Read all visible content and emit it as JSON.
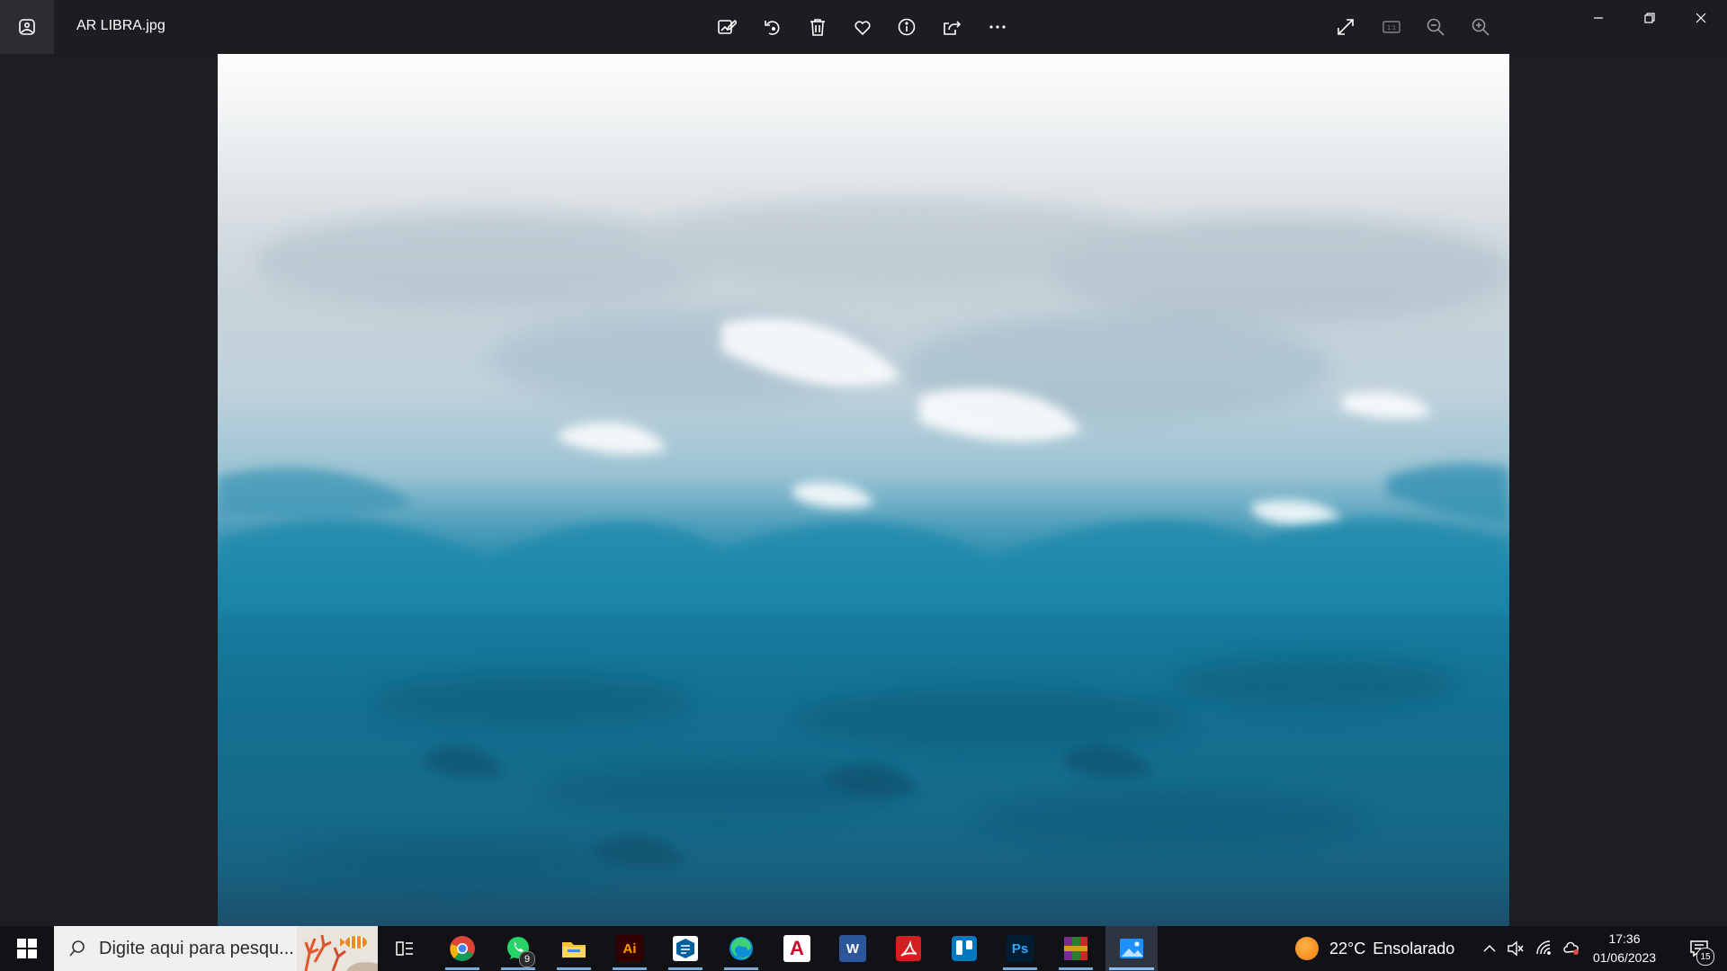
{
  "window": {
    "app_icon": "photos-app-icon",
    "title": "AR LIBRA.jpg",
    "toolbar": [
      {
        "name": "edit-image-button",
        "icon": "edit-image-icon"
      },
      {
        "name": "rotate-button",
        "icon": "rotate-icon"
      },
      {
        "name": "delete-button",
        "icon": "trash-icon"
      },
      {
        "name": "favorite-button",
        "icon": "heart-icon"
      },
      {
        "name": "info-button",
        "icon": "info-icon"
      },
      {
        "name": "share-button",
        "icon": "share-icon"
      },
      {
        "name": "more-button",
        "icon": "more-icon"
      }
    ],
    "view_controls": [
      {
        "name": "fullscreen-button",
        "icon": "expand-icon"
      },
      {
        "name": "actual-size-button",
        "icon": "one-to-one-icon",
        "label": "1:1",
        "disabled": true
      },
      {
        "name": "zoom-out-button",
        "icon": "zoom-out-icon"
      },
      {
        "name": "zoom-in-button",
        "icon": "zoom-in-icon"
      }
    ],
    "window_controls": [
      "minimize-icon",
      "restore-icon",
      "close-icon"
    ]
  },
  "image": {
    "description_icon": "abstract-sky-ocean-painting",
    "palette": [
      "#fdfdfd",
      "#c1d2dc",
      "#1f86a8",
      "#146f90",
      "#1c4f6b"
    ]
  },
  "taskbar": {
    "search_placeholder": "Digite aqui para pesqu...",
    "apps": [
      {
        "name": "chrome",
        "running": true
      },
      {
        "name": "whatsapp",
        "running": true,
        "badge": "9"
      },
      {
        "name": "file-explorer",
        "running": true
      },
      {
        "name": "illustrator",
        "label": "Ai",
        "running": true
      },
      {
        "name": "sketchup",
        "running": true
      },
      {
        "name": "edge",
        "running": true
      },
      {
        "name": "autocad",
        "label": "A",
        "running": false
      },
      {
        "name": "word",
        "label": "W",
        "running": false
      },
      {
        "name": "acrobat",
        "running": false
      },
      {
        "name": "trello",
        "running": false
      },
      {
        "name": "photoshop",
        "label": "Ps",
        "running": true
      },
      {
        "name": "winrar",
        "running": true
      },
      {
        "name": "photos",
        "running": true,
        "active": true
      }
    ],
    "weather": {
      "temp": "22°C",
      "condition": "Ensolarado"
    },
    "clock": {
      "time": "17:36",
      "date": "01/06/2023"
    },
    "notifications": "15",
    "accent": "#8cbcf0"
  }
}
